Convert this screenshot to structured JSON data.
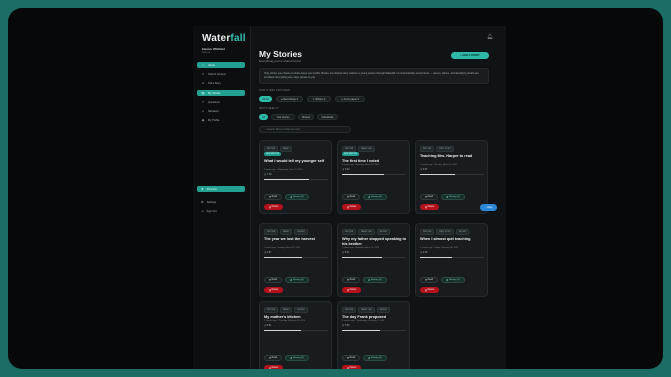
{
  "app": {
    "logo_main": "Water",
    "logo_accent": "fall"
  },
  "user": {
    "name": "Eleanor Whitfield",
    "link": "Log out"
  },
  "sidebar": {
    "items": [
      {
        "label": "Home",
        "icon": "home-icon",
        "active": true
      },
      {
        "label": "Submit Content",
        "icon": "upload-icon",
        "active": false
      },
      {
        "label": "Tell a Story",
        "icon": "mic-icon",
        "active": false
      },
      {
        "label": "My Stories",
        "icon": "book-icon",
        "active": true
      },
      {
        "label": "Questions",
        "icon": "question-icon",
        "active": false
      },
      {
        "label": "Narrators",
        "icon": "users-icon",
        "active": false
      },
      {
        "label": "My Profile",
        "icon": "user-icon",
        "active": false
      }
    ],
    "premium": "Premium",
    "settings": "Settings",
    "signout": "Sign Out"
  },
  "header": {
    "title": "My Stories",
    "subtitle": "Everything you've shared so far.",
    "add_button": "+ ADD A STORY"
  },
  "notice": "Only stories you choose to share leave your profile. Before any shared story reaches a young person through Waterfall, it's automatically anonymized — names, places, and identifying details are scrubbed. Everything else stays private to you.",
  "capture_section": {
    "label": "HOW IT WAS CAPTURED",
    "pills": [
      {
        "label": "All",
        "count": "10",
        "active": true
      },
      {
        "label": "Recordings",
        "count": "4",
        "active": false
      },
      {
        "label": "Written",
        "count": "4",
        "active": false
      },
      {
        "label": "From paper",
        "count": "2",
        "active": false
      }
    ]
  },
  "sharing_section": {
    "label": "WHO'S SEEN IT",
    "pills": [
      {
        "label": "All",
        "active": true
      },
      {
        "label": "Your stories",
        "active": false
      },
      {
        "label": "Shared",
        "active": false
      },
      {
        "label": "Individuals",
        "active": false
      }
    ]
  },
  "search": {
    "placeholder": "Search titles or what you said"
  },
  "cards": [
    {
      "tags": [
        "WRITTEN",
        "FAMILY"
      ],
      "badge": "NEW WRITTEN",
      "title": "What I would tell my younger self",
      "meta": "2 weeks ago · Wednesday, June 11, 2025",
      "duration": "7:18",
      "progress": 0.7,
      "read": "Read",
      "share": "Sharing (3)",
      "delete": "Delete"
    },
    {
      "tags": [
        "WRITTEN",
        "FAMILY LIFE"
      ],
      "badge": "NEW WRITTEN",
      "title": "The first time I voted",
      "meta": "4 weeks ago · Saturday, March 29, 2025",
      "duration": "7:02",
      "progress": 0.65,
      "read": "Read",
      "share": "Sharing (3)",
      "delete": "Delete"
    },
    {
      "tags": [
        "WRITTEN",
        "FIRST STORY"
      ],
      "badge": "",
      "title": "Teaching Mrs. Harper to read",
      "meta": "2 months ago · Monday, March 10, 2025",
      "duration": "3:07",
      "progress": 0.55,
      "read": "Read",
      "share": "Sharing (2)",
      "delete": "Delete"
    },
    {
      "tags": [
        "WRITTEN",
        "FAMILY",
        "RECENT"
      ],
      "badge": "",
      "title": "The year we lost the harvest",
      "meta": "1 month ago · Sunday, March 23, 2025",
      "duration": "4:37",
      "progress": 0.6,
      "read": "Read",
      "share": "Sharing (3)",
      "delete": "Delete"
    },
    {
      "tags": [
        "WRITTEN",
        "FAMILY LIFE",
        "RECENT"
      ],
      "badge": "",
      "title": "Why my father stopped speaking to his brother",
      "meta": "1 month ago · Saturday, March 15, 2025",
      "duration": "5:21",
      "progress": 0.62,
      "read": "Read",
      "share": "Sharing (3)",
      "delete": "Delete"
    },
    {
      "tags": [
        "WRITTEN",
        "FIRST STORY",
        "RECENT"
      ],
      "badge": "",
      "title": "When I almost quit teaching",
      "meta": "2 months ago · Friday, February 28, 2025",
      "duration": "2:45",
      "progress": 0.5,
      "read": "Read",
      "share": "Sharing (1)",
      "delete": "Delete"
    },
    {
      "tags": [
        "WRITTEN",
        "FAMILY",
        "RECENT"
      ],
      "badge": "",
      "title": "My mother's kitchen",
      "meta": "2 months ago · Thursday, February 13, 2025",
      "duration": "5:51",
      "progress": 0.58,
      "read": "Read",
      "share": "Sharing (3)",
      "delete": "Delete"
    },
    {
      "tags": [
        "WRITTEN",
        "FAMILY LIFE",
        "RECENT"
      ],
      "badge": "",
      "title": "The day Frank proposed",
      "meta": "3 months ago · Wednesday, February 5, 2025",
      "duration": "7:52",
      "progress": 0.6,
      "read": "Read",
      "share": "Sharing (3)",
      "delete": "Delete"
    }
  ],
  "help_button": "Help",
  "colors": {
    "accent": "#2fb9a9",
    "danger": "#b3111b",
    "background": "#101316",
    "frame_bg": "#1c6e65"
  }
}
